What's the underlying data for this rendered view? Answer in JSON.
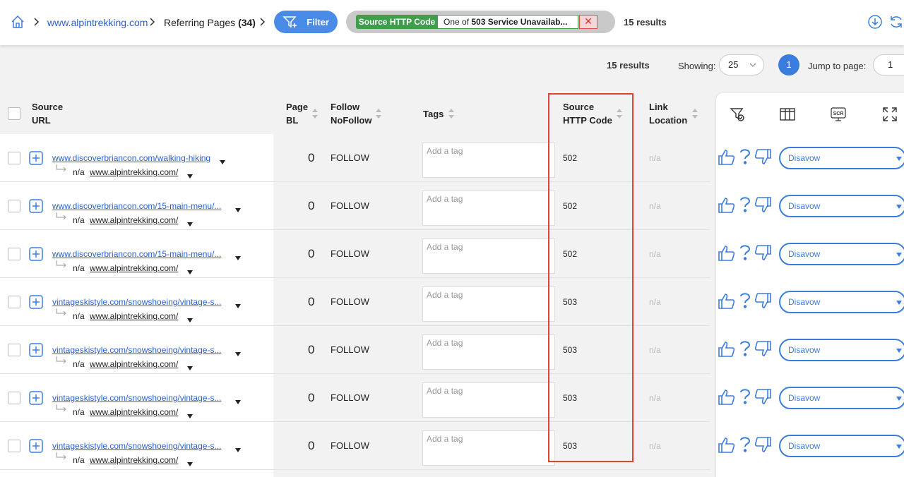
{
  "breadcrumb": {
    "domain": "www.alpintrekking.com",
    "section": "Referring Pages",
    "count": "(34)"
  },
  "filter": {
    "button_label": "Filter",
    "chip_field": "Source HTTP Code",
    "chip_prefix": "One of",
    "chip_value": "503 Service Unavailab..."
  },
  "top_results": "15 results",
  "pagination": {
    "results": "15 results",
    "showing_label": "Showing:",
    "showing_value": "25",
    "current_page": "1",
    "jump_label": "Jump to page:",
    "jump_value": "1"
  },
  "columns": {
    "source_url_1": "Source",
    "source_url_2": "URL",
    "page_bl_1": "Page",
    "page_bl_2": "BL",
    "follow_1": "Follow",
    "follow_2": "NoFollow",
    "tags": "Tags",
    "http_1": "Source",
    "http_2": "HTTP Code",
    "link_loc_1": "Link",
    "link_loc_2": "Location"
  },
  "tag_placeholder": "Add a tag",
  "disavow_label": "Disavow",
  "rows": [
    {
      "source_url": "www.discoverbriancon.com/walking-hiking",
      "sub_na": "n/a",
      "target_url": "www.alpintrekking.com/",
      "page_bl": "0",
      "follow": "FOLLOW",
      "http_code": "502",
      "link_location": "n/a"
    },
    {
      "source_url": "www.discoverbriancon.com/15-main-menu/...",
      "sub_na": "n/a",
      "target_url": "www.alpintrekking.com/",
      "page_bl": "0",
      "follow": "FOLLOW",
      "http_code": "502",
      "link_location": "n/a"
    },
    {
      "source_url": "www.discoverbriancon.com/15-main-menu/...",
      "sub_na": "n/a",
      "target_url": "www.alpintrekking.com/",
      "page_bl": "0",
      "follow": "FOLLOW",
      "http_code": "502",
      "link_location": "n/a"
    },
    {
      "source_url": "vintageskistyle.com/snowshoeing/vintage-s...",
      "sub_na": "n/a",
      "target_url": "www.alpintrekking.com/",
      "page_bl": "0",
      "follow": "FOLLOW",
      "http_code": "503",
      "link_location": "n/a"
    },
    {
      "source_url": "vintageskistyle.com/snowshoeing/vintage-s...",
      "sub_na": "n/a",
      "target_url": "www.alpintrekking.com/",
      "page_bl": "0",
      "follow": "FOLLOW",
      "http_code": "503",
      "link_location": "n/a"
    },
    {
      "source_url": "vintageskistyle.com/snowshoeing/vintage-s...",
      "sub_na": "n/a",
      "target_url": "www.alpintrekking.com/",
      "page_bl": "0",
      "follow": "FOLLOW",
      "http_code": "503",
      "link_location": "n/a"
    },
    {
      "source_url": "vintageskistyle.com/snowshoeing/vintage-s...",
      "sub_na": "n/a",
      "target_url": "www.alpintrekking.com/",
      "page_bl": "0",
      "follow": "FOLLOW",
      "http_code": "503",
      "link_location": "n/a"
    }
  ],
  "colors": {
    "accent": "#3b7ddd",
    "chip_green": "#3e9e4b",
    "highlight_red": "#e0442e"
  },
  "icons": [
    "home-icon",
    "chevron-right-icon",
    "funnel-plus-icon",
    "close-icon",
    "download-icon",
    "refresh-icon",
    "tag-filter-icon",
    "columns-icon",
    "screenshot-icon",
    "expand-icon",
    "expand-row-icon",
    "thumbs-up-icon",
    "question-icon",
    "thumbs-down-icon"
  ]
}
